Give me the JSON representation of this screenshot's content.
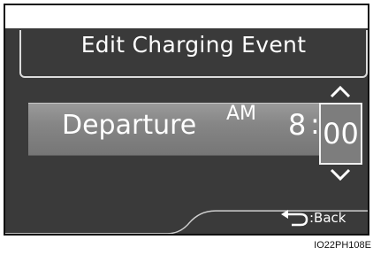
{
  "screen": {
    "title": "Edit Charging Event"
  },
  "event": {
    "label": "Departure",
    "ampm": "AM",
    "hour": "8",
    "separator": ":",
    "minute": "00"
  },
  "controls": {
    "up_icon": "chevron-up-icon",
    "down_icon": "chevron-down-icon",
    "back_icon": "return-arrow-icon",
    "back_label": ":Back"
  },
  "caption": "IO22PH108E"
}
